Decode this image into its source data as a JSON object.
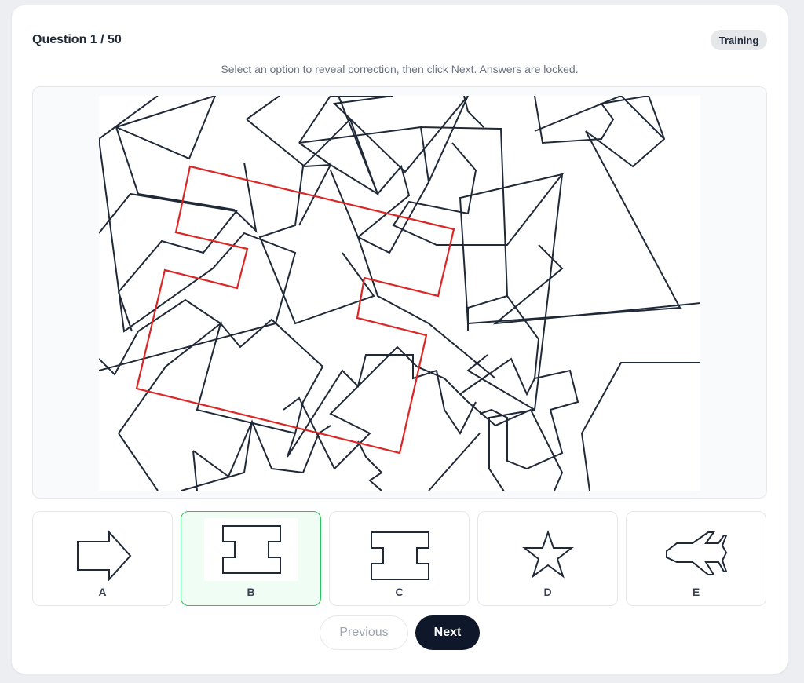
{
  "header": {
    "question_label": "Question 1 / 50",
    "mode_badge": "Training"
  },
  "instructions": "Select an option to reveal correction, then click Next. Answers are locked.",
  "puzzle": {
    "outline_color": "#1f2937",
    "highlight_color": "#dc2626"
  },
  "options": [
    {
      "label": "A",
      "shape": "arrow-right-icon",
      "selected": false
    },
    {
      "label": "B",
      "shape": "notched-rectangle-icon",
      "selected": true
    },
    {
      "label": "C",
      "shape": "notched-rectangle-icon",
      "selected": false
    },
    {
      "label": "D",
      "shape": "star-icon",
      "selected": false
    },
    {
      "label": "E",
      "shape": "airplane-icon",
      "selected": false
    }
  ],
  "nav": {
    "previous_label": "Previous",
    "next_label": "Next"
  },
  "colors": {
    "selected_border": "#22c55e",
    "selected_background": "#f0fdf4",
    "primary_button": "#0f172a"
  }
}
